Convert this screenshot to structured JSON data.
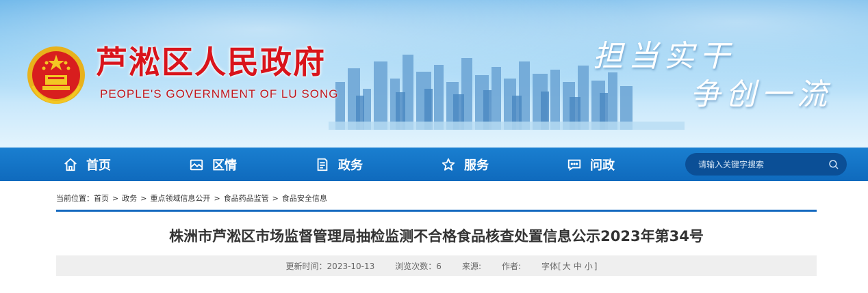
{
  "header": {
    "site_title": "芦淞区人民政府",
    "site_subtitle": "PEOPLE'S GOVERNMENT OF  LU SONG",
    "slogan_line1": "担当实干",
    "slogan_line2": "争创一流"
  },
  "nav": {
    "items": [
      {
        "label": "首页",
        "icon": "home-icon"
      },
      {
        "label": "区情",
        "icon": "picture-icon"
      },
      {
        "label": "政务",
        "icon": "document-icon"
      },
      {
        "label": "服务",
        "icon": "star-icon"
      },
      {
        "label": "问政",
        "icon": "chat-icon"
      }
    ],
    "search_placeholder": "请输入关键字搜索"
  },
  "breadcrumb": {
    "prefix": "当前位置：",
    "items": [
      "首页",
      "政务",
      "重点领域信息公开",
      "食品药品监管",
      "食品安全信息"
    ],
    "separator": ">"
  },
  "article": {
    "title": "株洲市芦淞区市场监督管理局抽检监测不合格食品核查处置信息公示2023年第34号",
    "updated": "更新时间：2023-10-13",
    "views": "浏览次数：6",
    "source": "来源:",
    "author": "作者:",
    "font_size_label": "字体[",
    "font_large": "大",
    "font_medium": "中",
    "font_small": "小",
    "font_size_close": "]"
  },
  "colors": {
    "brand_red": "#d9141b",
    "nav_blue": "#0f6abd",
    "rule_blue": "#1469bf"
  }
}
